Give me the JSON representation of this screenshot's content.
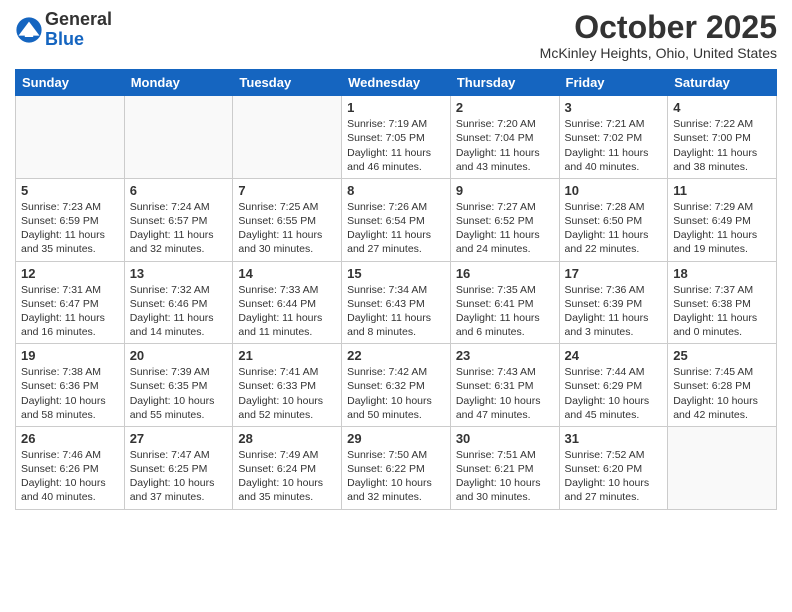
{
  "header": {
    "logo_general": "General",
    "logo_blue": "Blue",
    "month_title": "October 2025",
    "location": "McKinley Heights, Ohio, United States"
  },
  "days_of_week": [
    "Sunday",
    "Monday",
    "Tuesday",
    "Wednesday",
    "Thursday",
    "Friday",
    "Saturday"
  ],
  "weeks": [
    [
      {
        "day": "",
        "info": ""
      },
      {
        "day": "",
        "info": ""
      },
      {
        "day": "",
        "info": ""
      },
      {
        "day": "1",
        "info": "Sunrise: 7:19 AM\nSunset: 7:05 PM\nDaylight: 11 hours\nand 46 minutes."
      },
      {
        "day": "2",
        "info": "Sunrise: 7:20 AM\nSunset: 7:04 PM\nDaylight: 11 hours\nand 43 minutes."
      },
      {
        "day": "3",
        "info": "Sunrise: 7:21 AM\nSunset: 7:02 PM\nDaylight: 11 hours\nand 40 minutes."
      },
      {
        "day": "4",
        "info": "Sunrise: 7:22 AM\nSunset: 7:00 PM\nDaylight: 11 hours\nand 38 minutes."
      }
    ],
    [
      {
        "day": "5",
        "info": "Sunrise: 7:23 AM\nSunset: 6:59 PM\nDaylight: 11 hours\nand 35 minutes."
      },
      {
        "day": "6",
        "info": "Sunrise: 7:24 AM\nSunset: 6:57 PM\nDaylight: 11 hours\nand 32 minutes."
      },
      {
        "day": "7",
        "info": "Sunrise: 7:25 AM\nSunset: 6:55 PM\nDaylight: 11 hours\nand 30 minutes."
      },
      {
        "day": "8",
        "info": "Sunrise: 7:26 AM\nSunset: 6:54 PM\nDaylight: 11 hours\nand 27 minutes."
      },
      {
        "day": "9",
        "info": "Sunrise: 7:27 AM\nSunset: 6:52 PM\nDaylight: 11 hours\nand 24 minutes."
      },
      {
        "day": "10",
        "info": "Sunrise: 7:28 AM\nSunset: 6:50 PM\nDaylight: 11 hours\nand 22 minutes."
      },
      {
        "day": "11",
        "info": "Sunrise: 7:29 AM\nSunset: 6:49 PM\nDaylight: 11 hours\nand 19 minutes."
      }
    ],
    [
      {
        "day": "12",
        "info": "Sunrise: 7:31 AM\nSunset: 6:47 PM\nDaylight: 11 hours\nand 16 minutes."
      },
      {
        "day": "13",
        "info": "Sunrise: 7:32 AM\nSunset: 6:46 PM\nDaylight: 11 hours\nand 14 minutes."
      },
      {
        "day": "14",
        "info": "Sunrise: 7:33 AM\nSunset: 6:44 PM\nDaylight: 11 hours\nand 11 minutes."
      },
      {
        "day": "15",
        "info": "Sunrise: 7:34 AM\nSunset: 6:43 PM\nDaylight: 11 hours\nand 8 minutes."
      },
      {
        "day": "16",
        "info": "Sunrise: 7:35 AM\nSunset: 6:41 PM\nDaylight: 11 hours\nand 6 minutes."
      },
      {
        "day": "17",
        "info": "Sunrise: 7:36 AM\nSunset: 6:39 PM\nDaylight: 11 hours\nand 3 minutes."
      },
      {
        "day": "18",
        "info": "Sunrise: 7:37 AM\nSunset: 6:38 PM\nDaylight: 11 hours\nand 0 minutes."
      }
    ],
    [
      {
        "day": "19",
        "info": "Sunrise: 7:38 AM\nSunset: 6:36 PM\nDaylight: 10 hours\nand 58 minutes."
      },
      {
        "day": "20",
        "info": "Sunrise: 7:39 AM\nSunset: 6:35 PM\nDaylight: 10 hours\nand 55 minutes."
      },
      {
        "day": "21",
        "info": "Sunrise: 7:41 AM\nSunset: 6:33 PM\nDaylight: 10 hours\nand 52 minutes."
      },
      {
        "day": "22",
        "info": "Sunrise: 7:42 AM\nSunset: 6:32 PM\nDaylight: 10 hours\nand 50 minutes."
      },
      {
        "day": "23",
        "info": "Sunrise: 7:43 AM\nSunset: 6:31 PM\nDaylight: 10 hours\nand 47 minutes."
      },
      {
        "day": "24",
        "info": "Sunrise: 7:44 AM\nSunset: 6:29 PM\nDaylight: 10 hours\nand 45 minutes."
      },
      {
        "day": "25",
        "info": "Sunrise: 7:45 AM\nSunset: 6:28 PM\nDaylight: 10 hours\nand 42 minutes."
      }
    ],
    [
      {
        "day": "26",
        "info": "Sunrise: 7:46 AM\nSunset: 6:26 PM\nDaylight: 10 hours\nand 40 minutes."
      },
      {
        "day": "27",
        "info": "Sunrise: 7:47 AM\nSunset: 6:25 PM\nDaylight: 10 hours\nand 37 minutes."
      },
      {
        "day": "28",
        "info": "Sunrise: 7:49 AM\nSunset: 6:24 PM\nDaylight: 10 hours\nand 35 minutes."
      },
      {
        "day": "29",
        "info": "Sunrise: 7:50 AM\nSunset: 6:22 PM\nDaylight: 10 hours\nand 32 minutes."
      },
      {
        "day": "30",
        "info": "Sunrise: 7:51 AM\nSunset: 6:21 PM\nDaylight: 10 hours\nand 30 minutes."
      },
      {
        "day": "31",
        "info": "Sunrise: 7:52 AM\nSunset: 6:20 PM\nDaylight: 10 hours\nand 27 minutes."
      },
      {
        "day": "",
        "info": ""
      }
    ]
  ]
}
